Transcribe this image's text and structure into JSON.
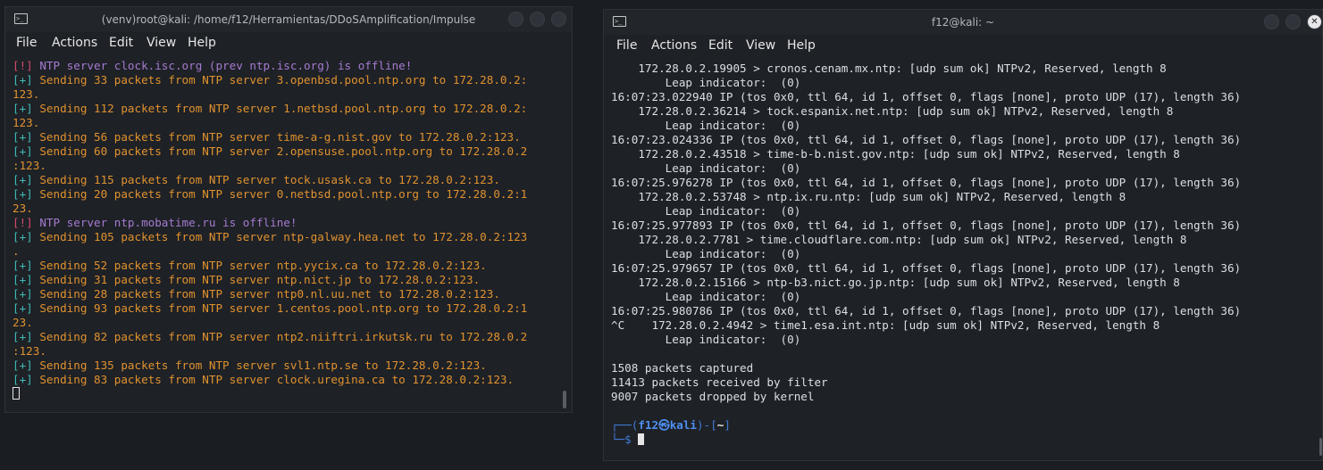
{
  "left_window": {
    "title": "(venv)root@kali: /home/f12/Herramientas/DDoSAmplification/Impulse",
    "menu": [
      "File",
      "Actions",
      "Edit",
      "View",
      "Help"
    ],
    "lines": [
      {
        "prefix": "[!]",
        "status": "warn",
        "text": " NTP server clock.isc.org (prev ntp.isc.org) is offline!"
      },
      {
        "prefix": "[+]",
        "status": "ok",
        "text": " Sending 33 packets from NTP server 3.openbsd.pool.ntp.org to 172.28.0.2:"
      },
      {
        "prefix": "",
        "status": "ok",
        "text": "123."
      },
      {
        "prefix": "[+]",
        "status": "ok",
        "text": " Sending 112 packets from NTP server 1.netbsd.pool.ntp.org to 172.28.0.2:"
      },
      {
        "prefix": "",
        "status": "ok",
        "text": "123."
      },
      {
        "prefix": "[+]",
        "status": "ok",
        "text": " Sending 56 packets from NTP server time-a-g.nist.gov to 172.28.0.2:123."
      },
      {
        "prefix": "[+]",
        "status": "ok",
        "text": " Sending 60 packets from NTP server 2.opensuse.pool.ntp.org to 172.28.0.2"
      },
      {
        "prefix": "",
        "status": "ok",
        "text": ":123."
      },
      {
        "prefix": "[+]",
        "status": "ok",
        "text": " Sending 115 packets from NTP server tock.usask.ca to 172.28.0.2:123."
      },
      {
        "prefix": "[+]",
        "status": "ok",
        "text": " Sending 20 packets from NTP server 0.netbsd.pool.ntp.org to 172.28.0.2:1"
      },
      {
        "prefix": "",
        "status": "ok",
        "text": "23."
      },
      {
        "prefix": "[!]",
        "status": "warn",
        "text": " NTP server ntp.mobatime.ru is offline!"
      },
      {
        "prefix": "[+]",
        "status": "ok",
        "text": " Sending 105 packets from NTP server ntp-galway.hea.net to 172.28.0.2:123"
      },
      {
        "prefix": "",
        "status": "ok",
        "text": "."
      },
      {
        "prefix": "[+]",
        "status": "ok",
        "text": " Sending 52 packets from NTP server ntp.yycix.ca to 172.28.0.2:123."
      },
      {
        "prefix": "[+]",
        "status": "ok",
        "text": " Sending 31 packets from NTP server ntp.nict.jp to 172.28.0.2:123."
      },
      {
        "prefix": "[+]",
        "status": "ok",
        "text": " Sending 28 packets from NTP server ntp0.nl.uu.net to 172.28.0.2:123."
      },
      {
        "prefix": "[+]",
        "status": "ok",
        "text": " Sending 93 packets from NTP server 1.centos.pool.ntp.org to 172.28.0.2:1"
      },
      {
        "prefix": "",
        "status": "ok",
        "text": "23."
      },
      {
        "prefix": "[+]",
        "status": "ok",
        "text": " Sending 82 packets from NTP server ntp2.niiftri.irkutsk.ru to 172.28.0.2"
      },
      {
        "prefix": "",
        "status": "ok",
        "text": ":123."
      },
      {
        "prefix": "[+]",
        "status": "ok",
        "text": " Sending 135 packets from NTP server svl1.ntp.se to 172.28.0.2:123."
      },
      {
        "prefix": "[+]",
        "status": "ok",
        "text": " Sending 83 packets from NTP server clock.uregina.ca to 172.28.0.2:123."
      }
    ]
  },
  "right_window": {
    "title": "f12@kali: ~",
    "menu": [
      "File",
      "Actions",
      "Edit",
      "View",
      "Help"
    ],
    "lines": [
      "    172.28.0.2.19905 > cronos.cenam.mx.ntp: [udp sum ok] NTPv2, Reserved, length 8",
      "        Leap indicator:  (0)",
      "16:07:23.022940 IP (tos 0x0, ttl 64, id 1, offset 0, flags [none], proto UDP (17), length 36)",
      "    172.28.0.2.36214 > tock.espanix.net.ntp: [udp sum ok] NTPv2, Reserved, length 8",
      "        Leap indicator:  (0)",
      "16:07:23.024336 IP (tos 0x0, ttl 64, id 1, offset 0, flags [none], proto UDP (17), length 36)",
      "    172.28.0.2.43518 > time-b-b.nist.gov.ntp: [udp sum ok] NTPv2, Reserved, length 8",
      "        Leap indicator:  (0)",
      "16:07:25.976278 IP (tos 0x0, ttl 64, id 1, offset 0, flags [none], proto UDP (17), length 36)",
      "    172.28.0.2.53748 > ntp.ix.ru.ntp: [udp sum ok] NTPv2, Reserved, length 8",
      "        Leap indicator:  (0)",
      "16:07:25.977893 IP (tos 0x0, ttl 64, id 1, offset 0, flags [none], proto UDP (17), length 36)",
      "    172.28.0.2.7781 > time.cloudflare.com.ntp: [udp sum ok] NTPv2, Reserved, length 8",
      "        Leap indicator:  (0)",
      "16:07:25.979657 IP (tos 0x0, ttl 64, id 1, offset 0, flags [none], proto UDP (17), length 36)",
      "    172.28.0.2.15166 > ntp-b3.nict.go.jp.ntp: [udp sum ok] NTPv2, Reserved, length 8",
      "        Leap indicator:  (0)",
      "16:07:25.980786 IP (tos 0x0, ttl 64, id 1, offset 0, flags [none], proto UDP (17), length 36)",
      "^C    172.28.0.2.4942 > time1.esa.int.ntp: [udp sum ok] NTPv2, Reserved, length 8",
      "        Leap indicator:  (0)",
      "",
      "1508 packets captured",
      "11413 packets received by filter",
      "9007 packets dropped by kernel",
      ""
    ],
    "prompt": {
      "open": "┌──(",
      "user": "f12",
      "at": "㉿",
      "host": "kali",
      "close": ")-[",
      "dir": "~",
      "end": "]",
      "line2": "└─$ "
    }
  },
  "colors": {
    "ok_prefix": "#3fb9b4",
    "warn_prefix": "#d44a6b",
    "ok_text": "#e0922f",
    "warn_text": "#a57ad0",
    "prompt": "#3f7bd6"
  }
}
